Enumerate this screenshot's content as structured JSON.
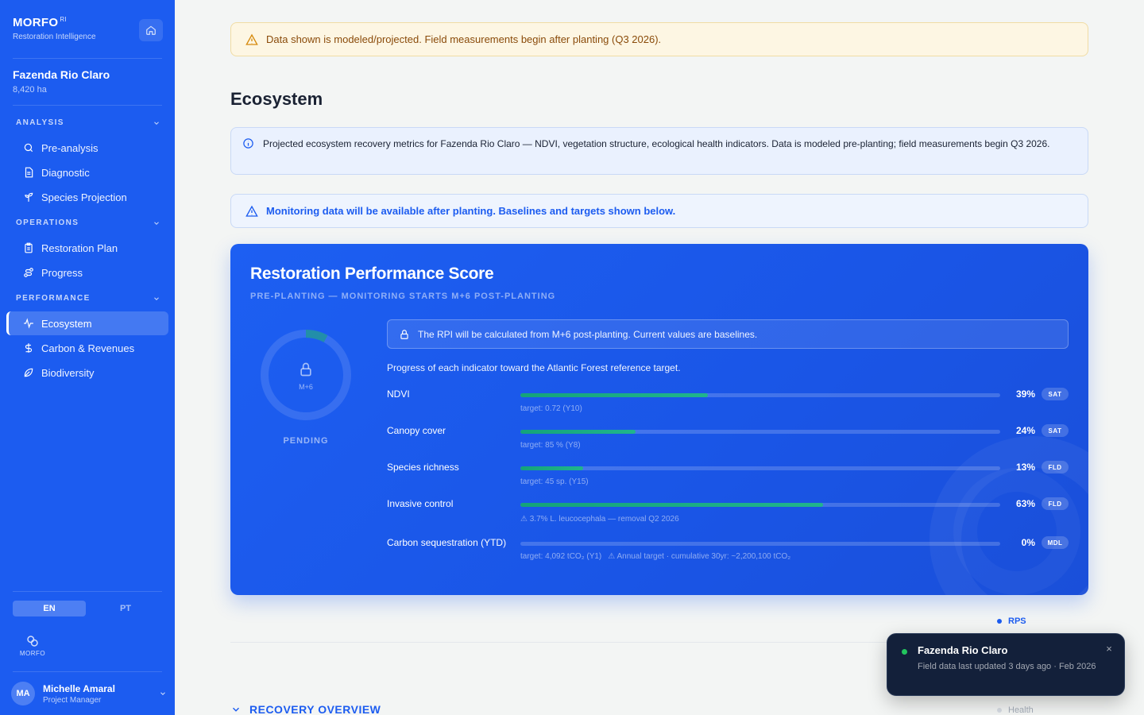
{
  "brand": {
    "name": "MORFO",
    "superscript": "RI",
    "subtitle": "Restoration Intelligence",
    "mini_logo_text": "MORFO"
  },
  "farm": {
    "name": "Fazenda Rio Claro",
    "area": "8,420 ha"
  },
  "sidebar": {
    "sections": [
      {
        "title": "ANALYSIS",
        "items": [
          {
            "label": "Pre-analysis",
            "icon": "search-icon"
          },
          {
            "label": "Diagnostic",
            "icon": "document-icon"
          },
          {
            "label": "Species Projection",
            "icon": "sprout-icon"
          }
        ]
      },
      {
        "title": "OPERATIONS",
        "items": [
          {
            "label": "Restoration Plan",
            "icon": "clipboard-icon"
          },
          {
            "label": "Progress",
            "icon": "route-icon"
          }
        ]
      },
      {
        "title": "PERFORMANCE",
        "items": [
          {
            "label": "Ecosystem",
            "icon": "pulse-icon",
            "active": true
          },
          {
            "label": "Carbon & Revenues",
            "icon": "dollar-icon"
          },
          {
            "label": "Biodiversity",
            "icon": "leaf-icon"
          }
        ]
      }
    ],
    "lang": {
      "en": "EN",
      "pt": "PT",
      "selected": "EN"
    }
  },
  "user": {
    "initials": "MA",
    "name": "Michelle Amaral",
    "role": "Project Manager"
  },
  "main": {
    "warning": "Data shown is modeled/projected. Field measurements begin after planting (Q3 2026).",
    "title": "Ecosystem",
    "info": "Projected ecosystem recovery metrics for Fazenda Rio Claro — NDVI, vegetation structure, ecological health indicators. Data is modeled pre-planting; field measurements begin Q3 2026.",
    "notice": "Monitoring data will be available after planting. Baselines and targets shown below."
  },
  "score_card": {
    "title": "Restoration Performance Score",
    "subtitle": "PRE-PLANTING — MONITORING STARTS M+6 POST-PLANTING",
    "ring_label": "M+6",
    "ring_progress": 0.08,
    "status": "PENDING",
    "lock_note": "The RPI will be calculated from M+6 post-planting. Current values are baselines.",
    "intro": "Progress of each indicator toward the Atlantic Forest reference target.",
    "indicators": [
      {
        "name": "NDVI",
        "pct": 39,
        "pct_label": "39%",
        "tag": "SAT",
        "target": "target: 0.72 (Y10)"
      },
      {
        "name": "Canopy cover",
        "pct": 24,
        "pct_label": "24%",
        "tag": "SAT",
        "target": "target: 85 % (Y8)"
      },
      {
        "name": "Species richness",
        "pct": 13,
        "pct_label": "13%",
        "tag": "FLD",
        "target": "target: 45 sp. (Y15)"
      },
      {
        "name": "Invasive control",
        "pct": 63,
        "pct_label": "63%",
        "tag": "FLD",
        "target": "⚠ 3.7% L. leucocephala — removal Q2 2026"
      },
      {
        "name": "Carbon sequestration (YTD)",
        "pct": 0,
        "pct_label": "0%",
        "tag": "MDL",
        "target": "target: 4,092 tCO₂ (Y1)",
        "target_note": "⚠ Annual target · cumulative 30yr: ~2,200,100 tCO₂"
      }
    ]
  },
  "legend": {
    "rps": "RPS",
    "health": "Health"
  },
  "recovery_title": "RECOVERY OVERVIEW",
  "toast": {
    "title": "Fazenda Rio Claro",
    "text": "Field data last updated 3 days ago · Feb 2026",
    "close": "×"
  },
  "colors": {
    "sidebar": "#1c5cf0",
    "accent": "#1c5cf0",
    "progress": "#14a37a",
    "warning_bg": "#fdf6e3"
  }
}
